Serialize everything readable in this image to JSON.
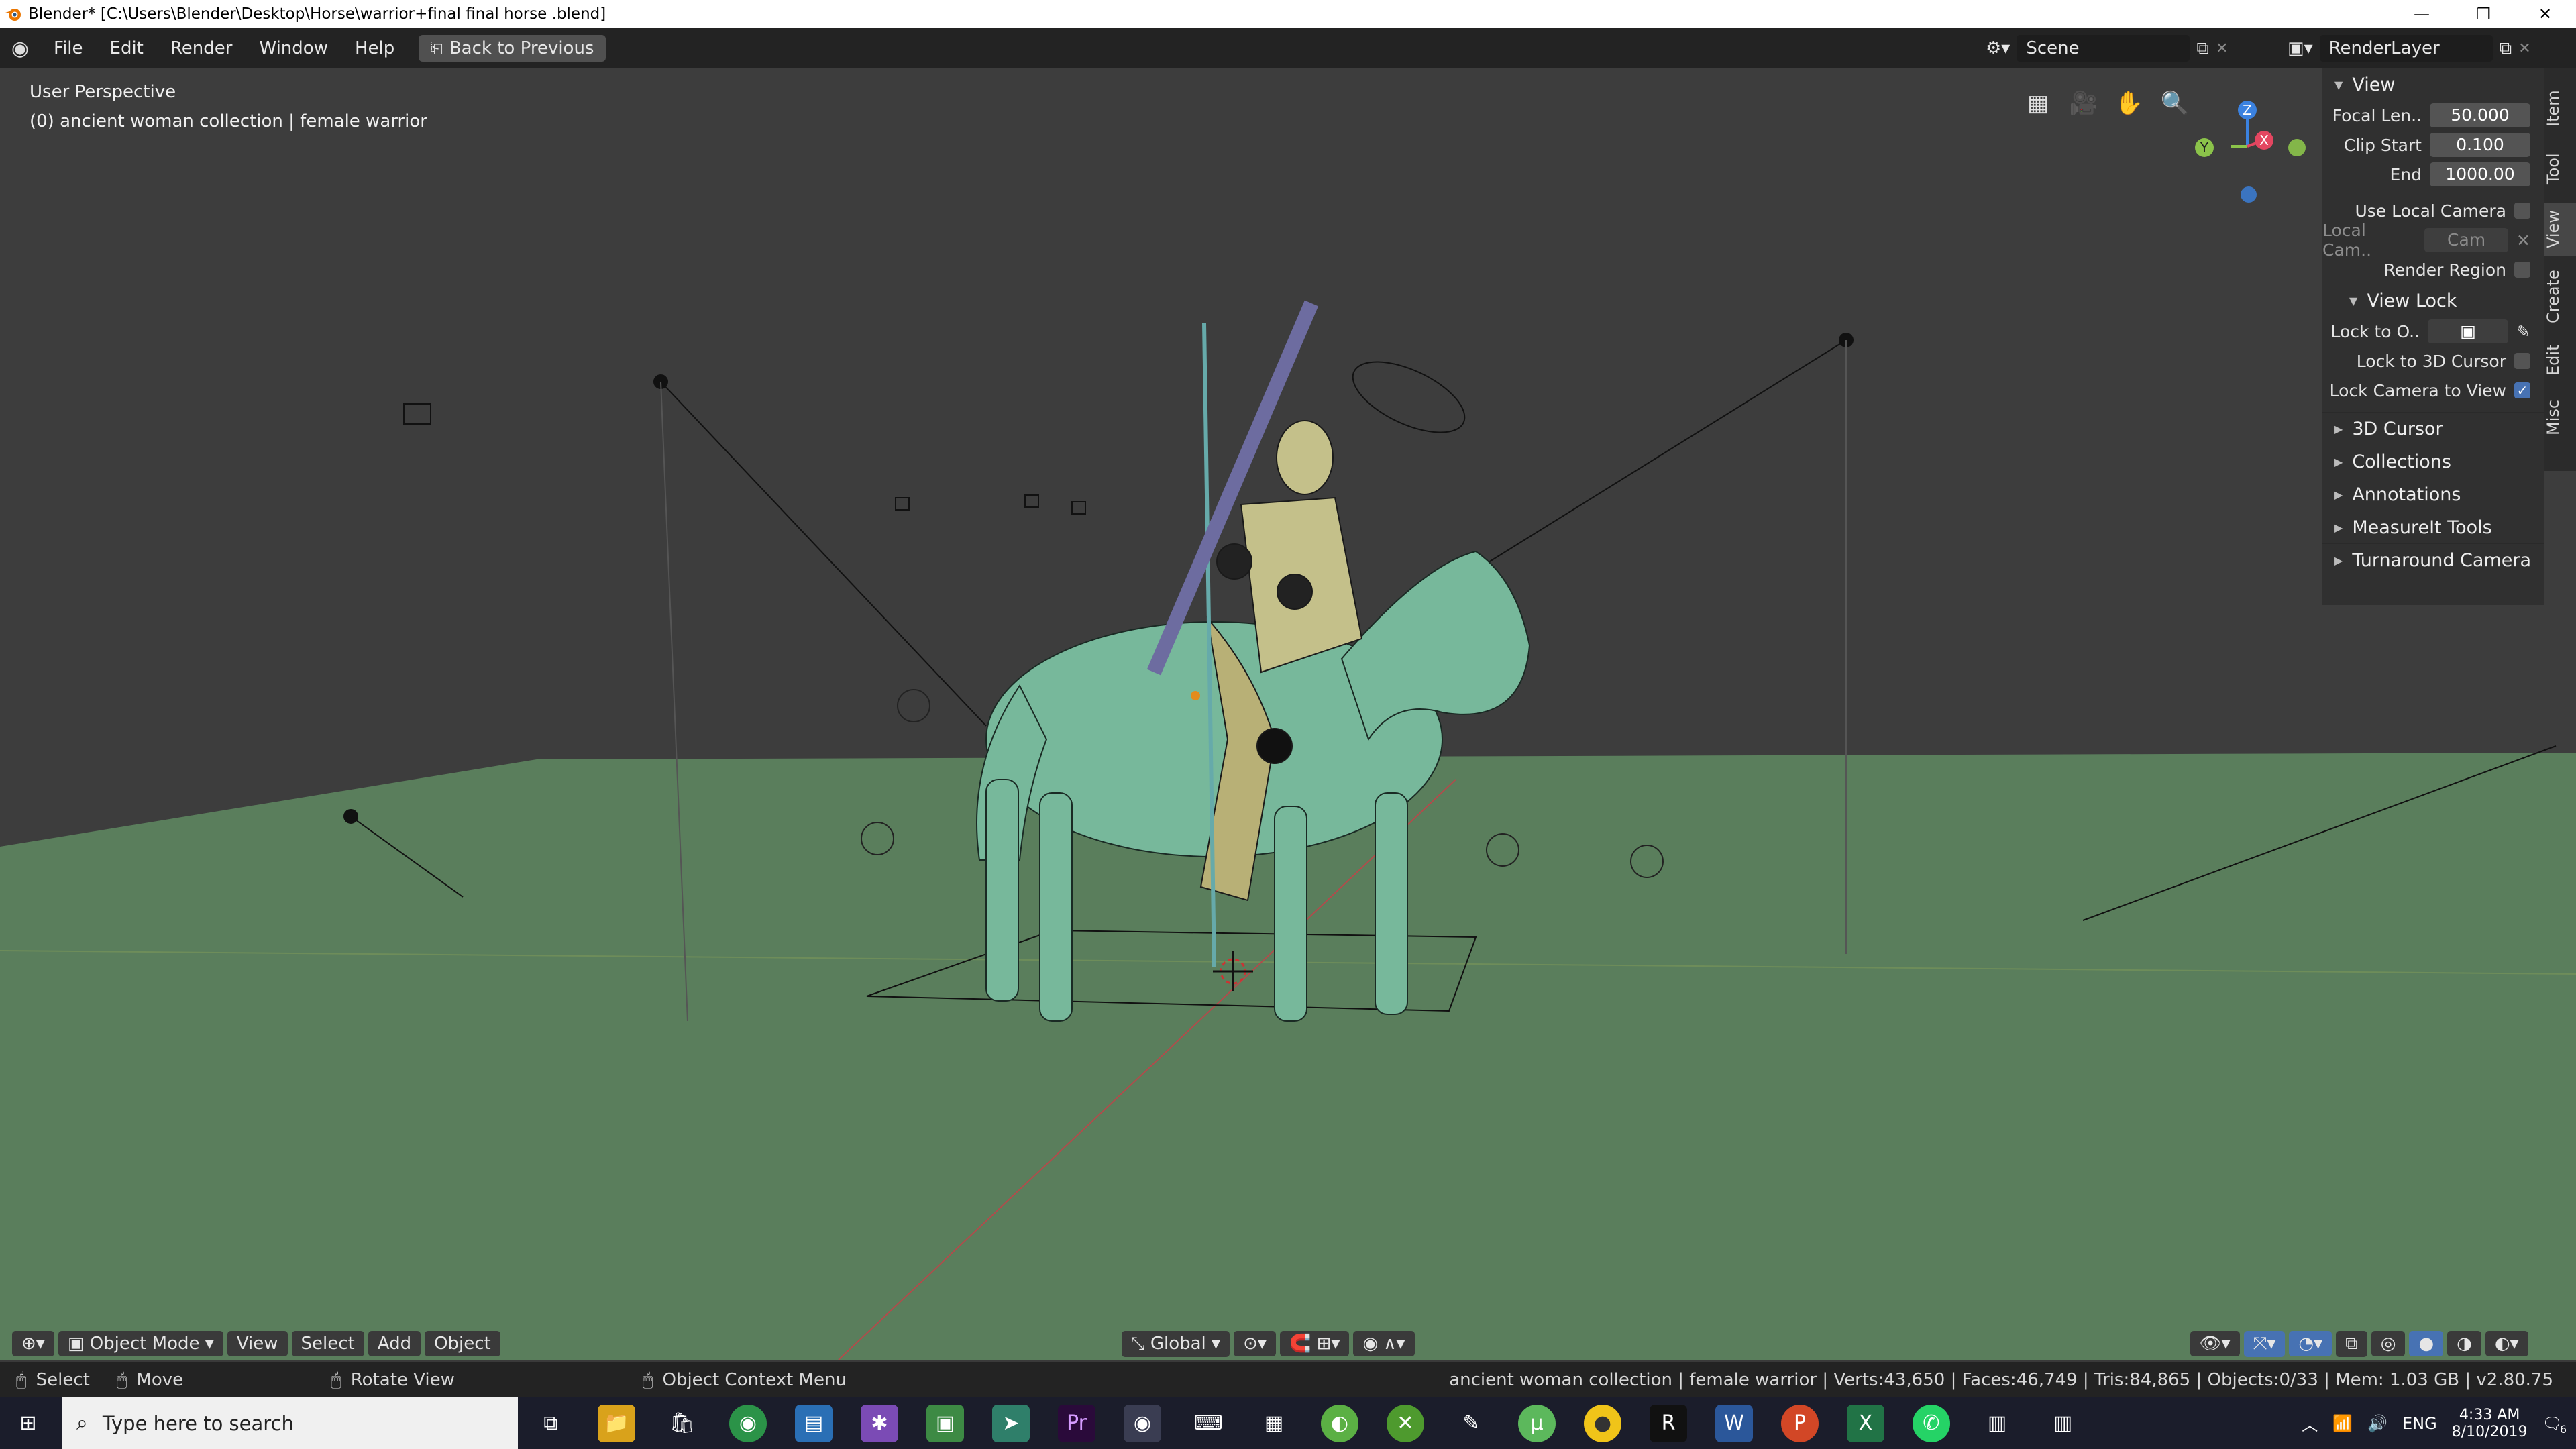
{
  "window": {
    "title": "Blender* [C:\\Users\\Blender\\Desktop\\Horse\\warrior+final final horse .blend]",
    "controls": [
      "minimize-icon",
      "restore-icon",
      "close-icon"
    ]
  },
  "menubar": {
    "items": [
      "File",
      "Edit",
      "Render",
      "Window",
      "Help"
    ],
    "back_label": "Back to Previous",
    "scene_label": "Scene",
    "renderlayer_label": "RenderLayer"
  },
  "viewport": {
    "perspective_label": "User Perspective",
    "collection_label": "(0) ancient woman collection | female warrior",
    "gizmo_axes": [
      "Z",
      "X",
      "Y"
    ],
    "colors": {
      "floor": "#5a7e5c",
      "sky": "#3d3d3d",
      "model": "#77b89b",
      "axis_x": "#e34660",
      "axis_y": "#8bc34a",
      "axis_z": "#3b82e0"
    }
  },
  "npanel": {
    "view_header": "View",
    "focal_label": "Focal Len..",
    "focal_value": "50.000",
    "clip_start_label": "Clip Start",
    "clip_start_value": "0.100",
    "clip_end_label": "End",
    "clip_end_value": "1000.00",
    "use_local_camera_label": "Use Local Camera",
    "local_cam_label": "Local Cam..",
    "local_cam_value": "Cam",
    "render_region_label": "Render Region",
    "view_lock_header": "View Lock",
    "lock_to_object_label": "Lock to O..",
    "lock_cursor_label": "Lock to 3D Cursor",
    "lock_camera_label": "Lock Camera to View",
    "lock_camera_checked": true,
    "sections": [
      "3D Cursor",
      "Collections",
      "Annotations",
      "MeasureIt Tools",
      "Turnaround Camera"
    ]
  },
  "sidetabs": [
    "Item",
    "Tool",
    "View",
    "Create",
    "Edit",
    "Misc"
  ],
  "vp_header": {
    "mode": "Object Mode",
    "menus": [
      "View",
      "Select",
      "Add",
      "Object"
    ],
    "orientation": "Global"
  },
  "statusbar": {
    "select": "Select",
    "move": "Move",
    "rotate": "Rotate View",
    "context": "Object Context Menu",
    "stats": "ancient woman collection | female warrior | Verts:43,650 | Faces:46,749 | Tris:84,865 | Objects:0/33 | Mem: 1.03 GB | v2.80.75"
  },
  "taskbar": {
    "search_placeholder": "Type here to search",
    "lang": "ENG",
    "time": "4:33 AM",
    "date": "8/10/2019",
    "notifications": "6"
  }
}
